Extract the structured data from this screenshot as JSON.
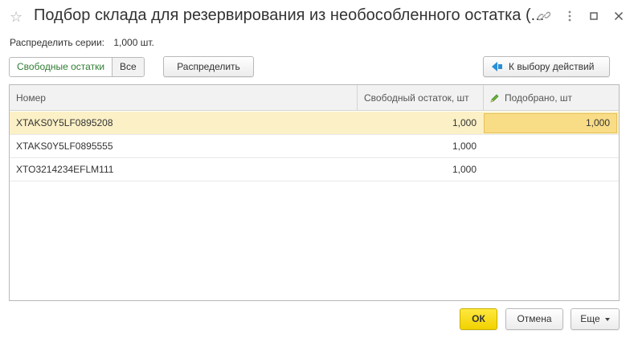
{
  "window": {
    "title": "Подбор склада для резервирования из необособленного остатка (...",
    "icons": [
      "star-icon",
      "link-icon",
      "more-vertical-icon",
      "maximize-icon",
      "close-icon"
    ]
  },
  "summary": {
    "label": "Распределить серии:",
    "value": "1,000 шт."
  },
  "toolbar": {
    "filter_free": "Свободные остатки",
    "filter_all": "Все",
    "distribute": "Распределить",
    "back_to_actions": "К выбору действий"
  },
  "table": {
    "columns": [
      "Номер",
      "Свободный остаток, шт",
      "Подобрано, шт"
    ],
    "rows": [
      {
        "number": "XTAKS0Y5LF0895208",
        "free": "1,000",
        "picked": "1,000"
      },
      {
        "number": "XTAKS0Y5LF0895555",
        "free": "1,000",
        "picked": ""
      },
      {
        "number": "XTO3214234EFLM111",
        "free": "1,000",
        "picked": ""
      }
    ]
  },
  "footer": {
    "ok": "ОК",
    "cancel": "Отмена",
    "more": "Еще"
  },
  "colors": {
    "accent_yellow": "#f1d200",
    "selected_row": "#fbf0c6",
    "selected_cell": "#f9dc86",
    "filter_active_text": "#2e7d32",
    "back_arrow": "#2a8fd8"
  }
}
